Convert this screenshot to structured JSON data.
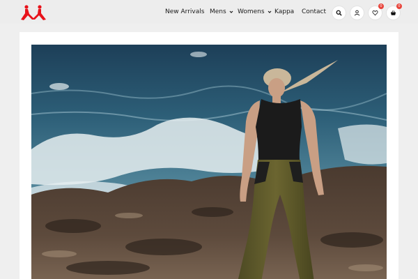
{
  "brand": {
    "logo_icon": "kappa-logo-icon",
    "accent": "#e8131b"
  },
  "nav": {
    "items": [
      {
        "label": "New Arrivals",
        "dropdown": false
      },
      {
        "label": "Mens",
        "dropdown": true
      },
      {
        "label": "Womens",
        "dropdown": true
      },
      {
        "label": "Kappa",
        "dropdown": false
      },
      {
        "label": "Contact",
        "dropdown": false
      }
    ]
  },
  "actions": {
    "search_icon": "search-icon",
    "account_icon": "user-icon",
    "wishlist": {
      "icon": "heart-icon",
      "count": "0"
    },
    "cart": {
      "icon": "basket-icon",
      "count": "0"
    }
  },
  "hero": {
    "image_icon": "hero-photo"
  },
  "colors": {
    "header_bg": "#ededed",
    "badge": "#e8443b",
    "page_bg": "#efefef"
  }
}
